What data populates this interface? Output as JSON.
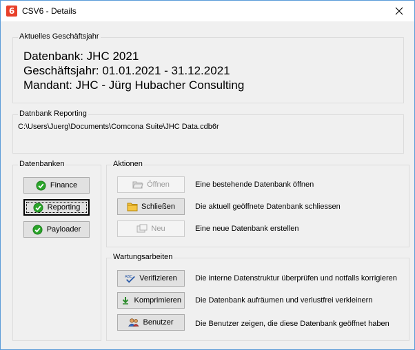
{
  "window": {
    "title": "CSV6 - Details",
    "app_icon_glyph": "6"
  },
  "current_year": {
    "legend": "Aktuelles Geschäftsjahr",
    "database_line": "Datenbank: JHC 2021",
    "fiscal_year_line": "Geschäftsjahr: 01.01.2021 - 31.12.2021",
    "client_line": "Mandant: JHC - Jürg Hubacher Consulting"
  },
  "reporting_db": {
    "legend": "Datnbank Reporting",
    "path": "C:\\Users\\Juerg\\Documents\\Comcona Suite\\JHC Data.cdb6r"
  },
  "databases": {
    "legend": "Datenbanken",
    "items": [
      {
        "label": "Finance",
        "icon": "green-check-icon"
      },
      {
        "label": "Reporting",
        "icon": "green-check-icon",
        "focused": true
      },
      {
        "label": "Payloader",
        "icon": "green-check-icon"
      }
    ]
  },
  "actions": {
    "legend": "Aktionen",
    "items": [
      {
        "label": "Öffnen",
        "icon": "open-folder-icon",
        "disabled": true,
        "description": "Eine bestehende Datenbank öffnen"
      },
      {
        "label": "Schließen",
        "icon": "folder-icon",
        "disabled": false,
        "description": "Die aktuell geöffnete Datenbank schliessen"
      },
      {
        "label": "Neu",
        "icon": "new-database-icon",
        "disabled": true,
        "description": "Eine neue Datenbank erstellen"
      }
    ]
  },
  "maintenance": {
    "legend": "Wartungsarbeiten",
    "items": [
      {
        "label": "Verifizieren",
        "icon": "spellcheck-icon",
        "description": "Die interne Datenstruktur überprüfen und notfalls korrigieren"
      },
      {
        "label": "Komprimieren",
        "icon": "compress-arrow-icon",
        "description": "Die Datenbank aufräumen und verlustfrei verkleinern"
      },
      {
        "label": "Benutzer",
        "icon": "users-icon",
        "description": "Die Benutzer zeigen, die diese Datenbank geöffnet haben"
      }
    ]
  },
  "colors": {
    "accent_border": "#5a9bd8",
    "check_green": "#2aa52a",
    "app_icon_red": "#e8402a"
  }
}
